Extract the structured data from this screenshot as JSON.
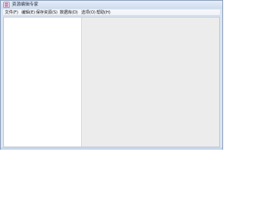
{
  "window": {
    "title": "资源编辑专家"
  },
  "menu": [
    {
      "label": "文件(F)"
    },
    {
      "label": "编辑(E)"
    },
    {
      "label": "保存资源(S)"
    },
    {
      "label": "数据库(D)"
    },
    {
      "label": "选项(O)"
    },
    {
      "label": "帮助(H)"
    }
  ],
  "icons": {
    "app": "app-icon"
  },
  "colors": {
    "frame": "#dbe5f1",
    "tree_background": "#ffffff",
    "main_background": "#ececec"
  }
}
